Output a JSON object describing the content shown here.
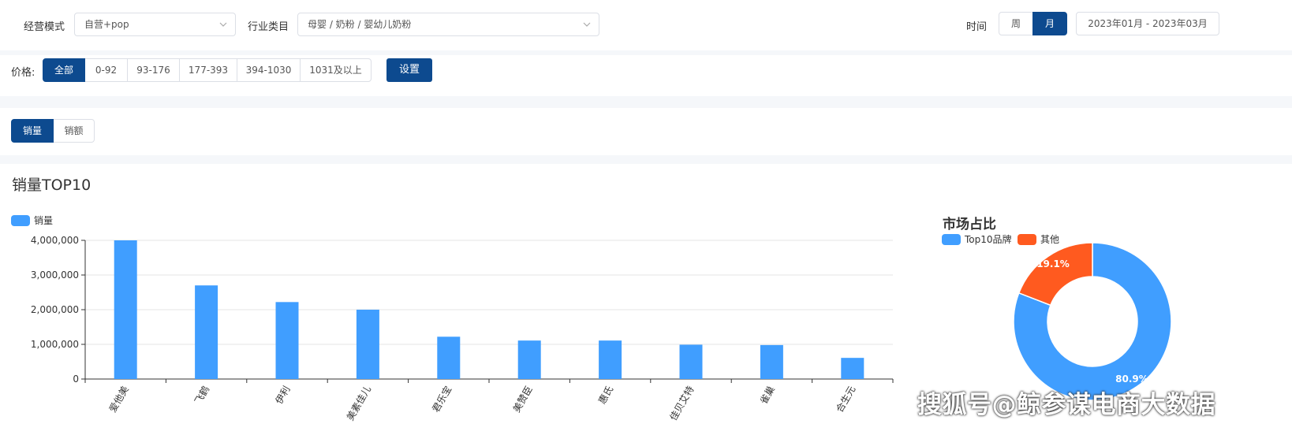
{
  "filters": {
    "mode_label": "经营模式",
    "mode_value": "自营+pop",
    "category_label": "行业类目",
    "category_value": "母婴 / 奶粉 / 婴幼儿奶粉",
    "time_label": "时间",
    "period_options": [
      "周",
      "月"
    ],
    "period_selected": "月",
    "date_range": "2023年01月 - 2023年03月"
  },
  "price": {
    "label": "价格:",
    "options": [
      "全部",
      "0-92",
      "93-176",
      "177-393",
      "394-1030",
      "1031及以上"
    ],
    "selected": "全部",
    "settings_label": "设置"
  },
  "metric_tabs": {
    "options": [
      "销量",
      "销额"
    ],
    "selected": "销量"
  },
  "section_title": "销量TOP10",
  "colors": {
    "primary": "#0d4a8f",
    "bar": "#409eff",
    "other": "#ff5a1f"
  },
  "watermark": "搜狐号@鲸参谋电商大数据",
  "chart_data": [
    {
      "type": "bar",
      "legend": [
        "销量"
      ],
      "categories": [
        "爱他美",
        "飞鹤",
        "伊利",
        "美素佳儿",
        "君乐宝",
        "美赞臣",
        "惠氏",
        "佳贝艾特",
        "雀巢",
        "合生元"
      ],
      "series": [
        {
          "name": "销量",
          "values": [
            4000000,
            2700000,
            2220000,
            2000000,
            1220000,
            1110000,
            1110000,
            990000,
            980000,
            610000
          ]
        }
      ],
      "y_ticks": [
        "0",
        "1,000,000",
        "2,000,000",
        "3,000,000",
        "4,000,000"
      ],
      "ylim": [
        0,
        4000000
      ],
      "grid": true,
      "legend_position": "top-left"
    },
    {
      "type": "pie",
      "title": "市场占比",
      "legend": [
        "Top10品牌",
        "其他"
      ],
      "slices": [
        {
          "name": "Top10品牌",
          "value": 80.9,
          "label": "80.9%",
          "color": "#409eff"
        },
        {
          "name": "其他",
          "value": 19.1,
          "label": "19.1%",
          "color": "#ff5a1f"
        }
      ],
      "legend_position": "top-left"
    }
  ]
}
